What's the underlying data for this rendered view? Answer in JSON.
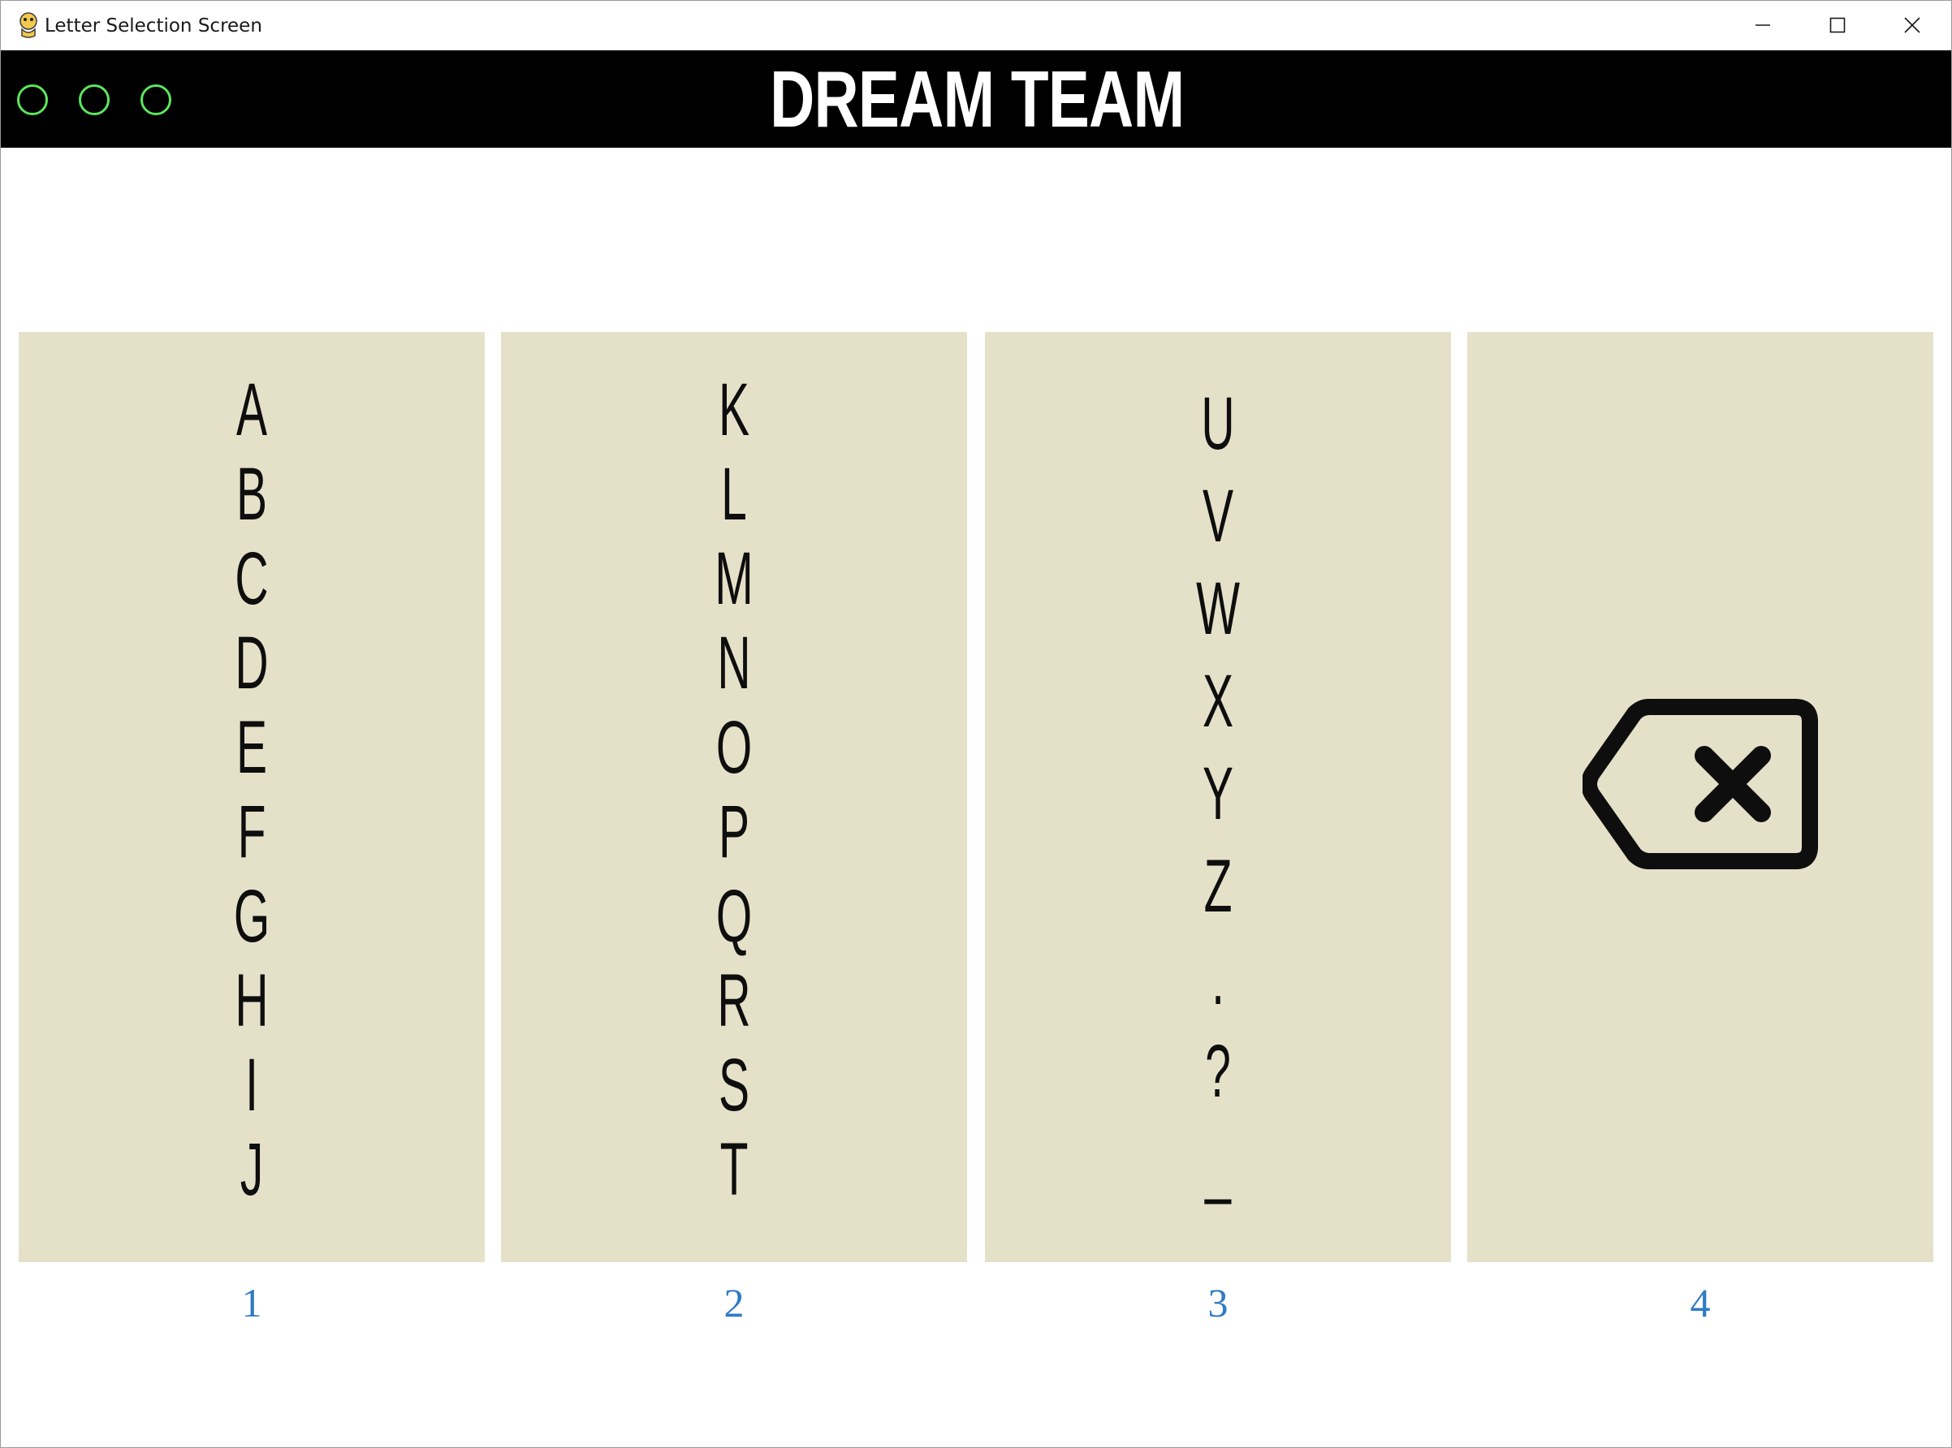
{
  "window": {
    "title": "Letter Selection Screen",
    "controls": [
      "minimize",
      "maximize",
      "close"
    ]
  },
  "header": {
    "title": "DREAM TEAM",
    "indicator_color": "#5ce65c",
    "indicators": [
      "circle-indicator",
      "circle-indicator",
      "circle-indicator"
    ]
  },
  "columns": [
    {
      "number": "1",
      "letters": [
        "A",
        "B",
        "C",
        "D",
        "E",
        "F",
        "G",
        "H",
        "I",
        "J"
      ]
    },
    {
      "number": "2",
      "letters": [
        "K",
        "L",
        "M",
        "N",
        "O",
        "P",
        "Q",
        "R",
        "S",
        "T"
      ]
    },
    {
      "number": "3",
      "letters": [
        "U",
        "V",
        "W",
        "X",
        "Y",
        "Z",
        ".",
        "?",
        "_"
      ]
    },
    {
      "number": "4",
      "icon": "backspace-icon"
    }
  ],
  "colors": {
    "panel_background": "#e5e1c9",
    "header_background": "#000000",
    "number_color": "#2f7bc4"
  }
}
